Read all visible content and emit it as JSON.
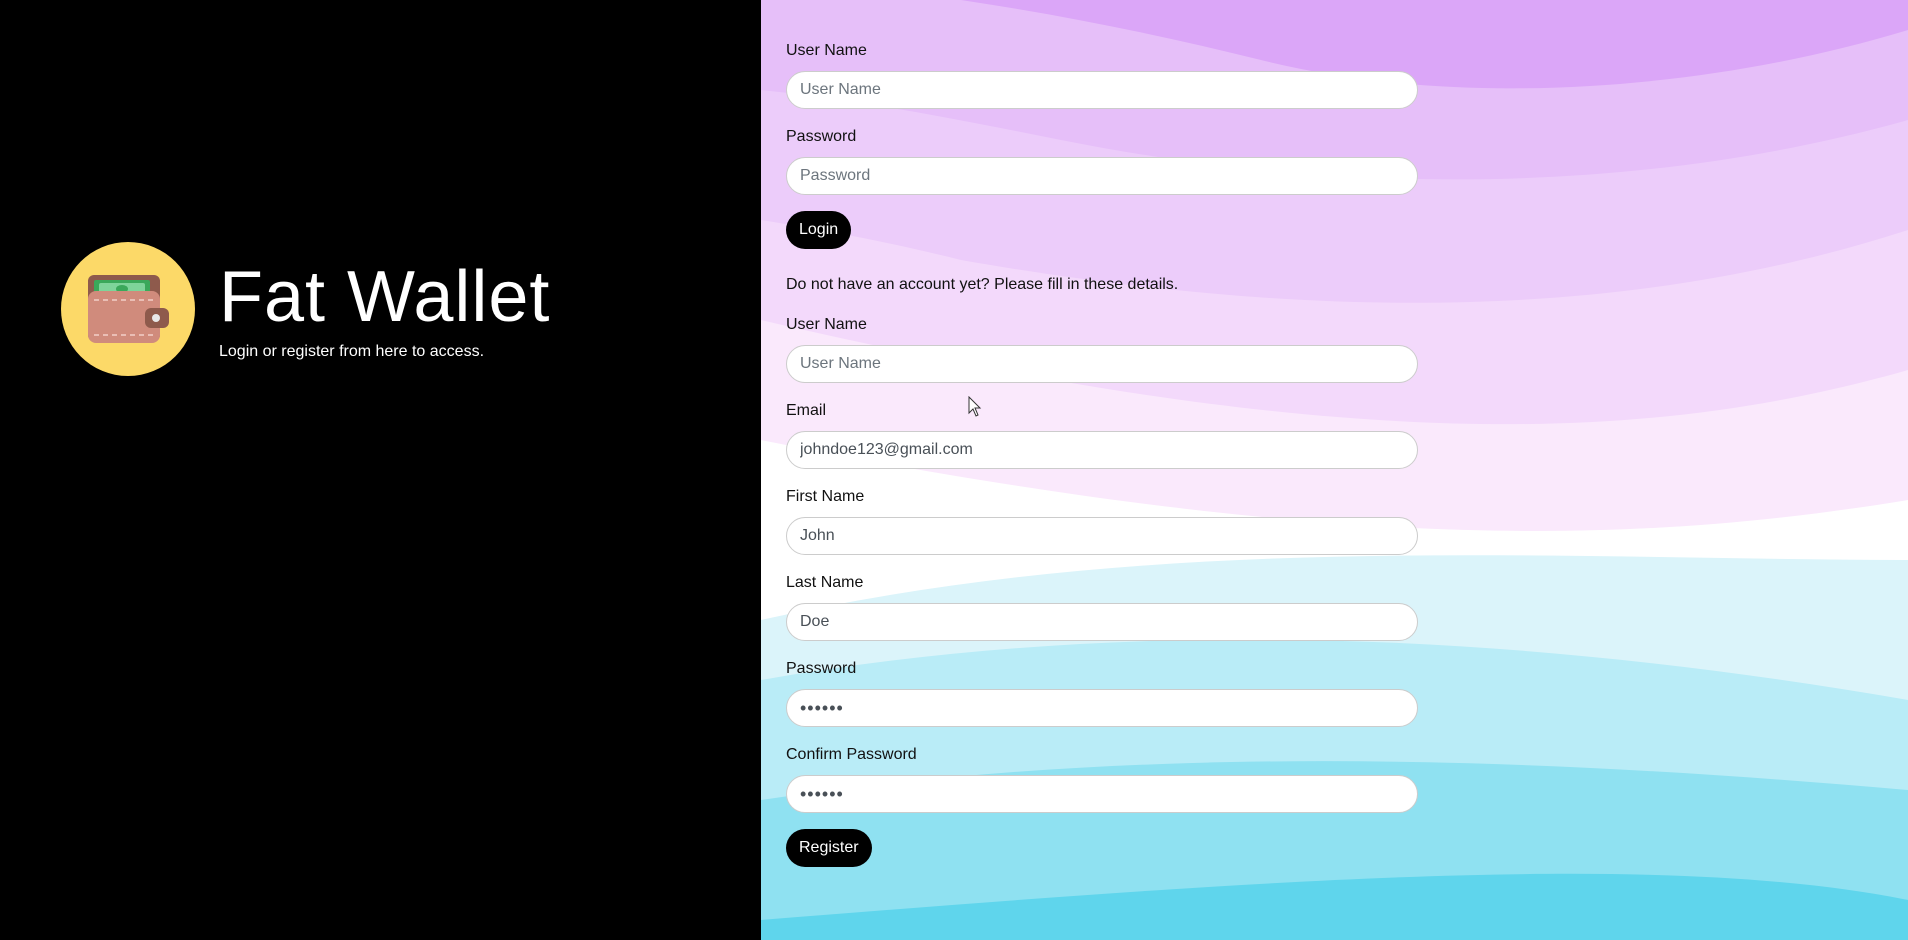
{
  "brand": {
    "title": "Fat Wallet",
    "subtitle": "Login or register from here to access.",
    "logo_icon": "wallet-icon"
  },
  "login": {
    "username_label": "User Name",
    "username_placeholder": "User Name",
    "password_label": "Password",
    "password_placeholder": "Password",
    "button_label": "Login"
  },
  "register": {
    "intro_text": "Do not have an account yet? Please fill in these details.",
    "username_label": "User Name",
    "username_placeholder": "User Name",
    "email_label": "Email",
    "email_value": "johndoe123@gmail.com",
    "first_name_label": "First Name",
    "first_name_value": "John",
    "last_name_label": "Last Name",
    "last_name_value": "Doe",
    "password_label": "Password",
    "password_value": "••••••",
    "confirm_password_label": "Confirm Password",
    "confirm_password_value": "••••••",
    "button_label": "Register"
  },
  "colors": {
    "left_bg": "#000000",
    "logo_circle": "#fcd968",
    "wave_purple": "#d9a0f7",
    "wave_cyan": "#5fd5ec",
    "button_bg": "#000000"
  }
}
